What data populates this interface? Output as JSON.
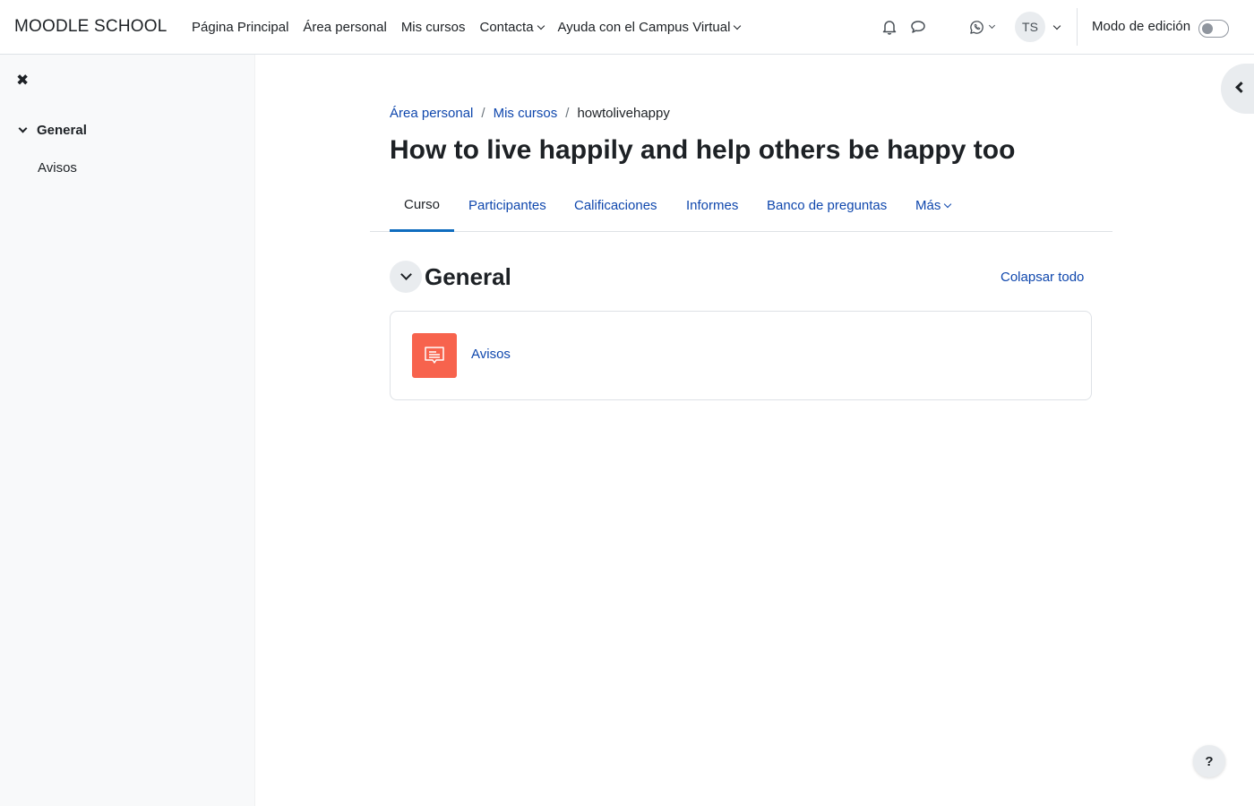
{
  "navbar": {
    "brand": "MOODLE SCHOOL",
    "links": [
      {
        "label": "Página Principal",
        "dropdown": false
      },
      {
        "label": "Área personal",
        "dropdown": false
      },
      {
        "label": "Mis cursos",
        "dropdown": false
      },
      {
        "label": "Contacta",
        "dropdown": true
      },
      {
        "label": "Ayuda con el Campus Virtual",
        "dropdown": true
      }
    ],
    "icons": [
      "bell-icon",
      "chat-bubble-icon",
      "whatsapp-icon"
    ],
    "user_initials": "TS",
    "edit_mode_label": "Modo de edición",
    "edit_mode_on": false
  },
  "drawer": {
    "close_symbol": "✖",
    "section_label": "General",
    "items": [
      "Avisos"
    ]
  },
  "breadcrumb": {
    "items": [
      "Área personal",
      "Mis cursos"
    ],
    "current": "howtolivehappy"
  },
  "course": {
    "title": "How to live happily and help others be happy too"
  },
  "tabs": [
    {
      "label": "Curso",
      "active": true
    },
    {
      "label": "Participantes",
      "active": false
    },
    {
      "label": "Calificaciones",
      "active": false
    },
    {
      "label": "Informes",
      "active": false
    },
    {
      "label": "Banco de preguntas",
      "active": false
    },
    {
      "label": "Más",
      "active": false,
      "dropdown": true
    }
  ],
  "section": {
    "title": "General",
    "collapse_all": "Colapsar todo",
    "activities": [
      {
        "name": "Avisos",
        "type": "forum",
        "icon": "forum-icon",
        "color": "#f7634d"
      }
    ]
  },
  "help": {
    "symbol": "?"
  },
  "colors": {
    "link": "#0f47ad",
    "active_tab_underline": "#0f6cbf",
    "forum_icon_bg": "#f7634d"
  }
}
